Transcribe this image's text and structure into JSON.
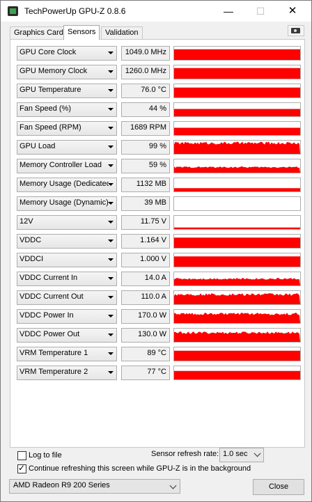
{
  "window": {
    "title": "TechPowerUp GPU-Z 0.8.6",
    "min": "—",
    "max": "☐",
    "close": "✕"
  },
  "tabs": [
    {
      "label": "Graphics Card",
      "active": false
    },
    {
      "label": "Sensors",
      "active": true
    },
    {
      "label": "Validation",
      "active": false
    }
  ],
  "sensors": [
    {
      "label": "GPU Core Clock",
      "value": "1049.0 MHz",
      "level": 0.8,
      "noise": "flat"
    },
    {
      "label": "GPU Memory Clock",
      "value": "1260.0 MHz",
      "level": 0.8,
      "noise": "flat"
    },
    {
      "label": "GPU Temperature",
      "value": "76.0 °C",
      "level": 0.75,
      "noise": "flat"
    },
    {
      "label": "Fan Speed (%)",
      "value": "44 %",
      "level": 0.55,
      "noise": "flat"
    },
    {
      "label": "Fan Speed (RPM)",
      "value": "1689 RPM",
      "level": 0.55,
      "noise": "flat"
    },
    {
      "label": "GPU Load",
      "value": "99 %",
      "level": 0.88,
      "noise": "spiky"
    },
    {
      "label": "Memory Controller Load",
      "value": "59 %",
      "level": 0.45,
      "noise": "spiky"
    },
    {
      "label": "Memory Usage (Dedicated)",
      "value": "1132 MB",
      "level": 0.25,
      "noise": "flat"
    },
    {
      "label": "Memory Usage (Dynamic)",
      "value": "39 MB",
      "level": 0.0,
      "noise": "flat"
    },
    {
      "label": "12V",
      "value": "11.75 V",
      "level": 0.12,
      "noise": "flat"
    },
    {
      "label": "VDDC",
      "value": "1.164 V",
      "level": 0.78,
      "noise": "flat"
    },
    {
      "label": "VDDCI",
      "value": "1.000 V",
      "level": 0.78,
      "noise": "flat"
    },
    {
      "label": "VDDC Current In",
      "value": "14.0 A",
      "level": 0.55,
      "noise": "spiky"
    },
    {
      "label": "VDDC Current Out",
      "value": "110.0 A",
      "level": 0.8,
      "noise": "spiky"
    },
    {
      "label": "VDDC Power In",
      "value": "170.0 W",
      "level": 0.75,
      "noise": "spiky"
    },
    {
      "label": "VDDC Power Out",
      "value": "130.0 W",
      "level": 0.75,
      "noise": "spiky"
    },
    {
      "label": "VRM Temperature 1",
      "value": "89 °C",
      "level": 0.75,
      "noise": "flat"
    },
    {
      "label": "VRM Temperature 2",
      "value": "77 °C",
      "level": 0.65,
      "noise": "flat"
    }
  ],
  "footer": {
    "log_label": "Log to file",
    "log_checked": false,
    "refresh_label": "Sensor refresh rate:",
    "refresh_value": "1.0 sec",
    "continue_label": "Continue refreshing this screen while GPU-Z is in the background",
    "continue_checked": true,
    "gpu_select": "AMD Radeon R9 200 Series",
    "close_label": "Close"
  },
  "colors": {
    "graph": "#ff0000"
  },
  "icons": {
    "app": "gpuz-app-icon",
    "camera": "camera-icon"
  }
}
